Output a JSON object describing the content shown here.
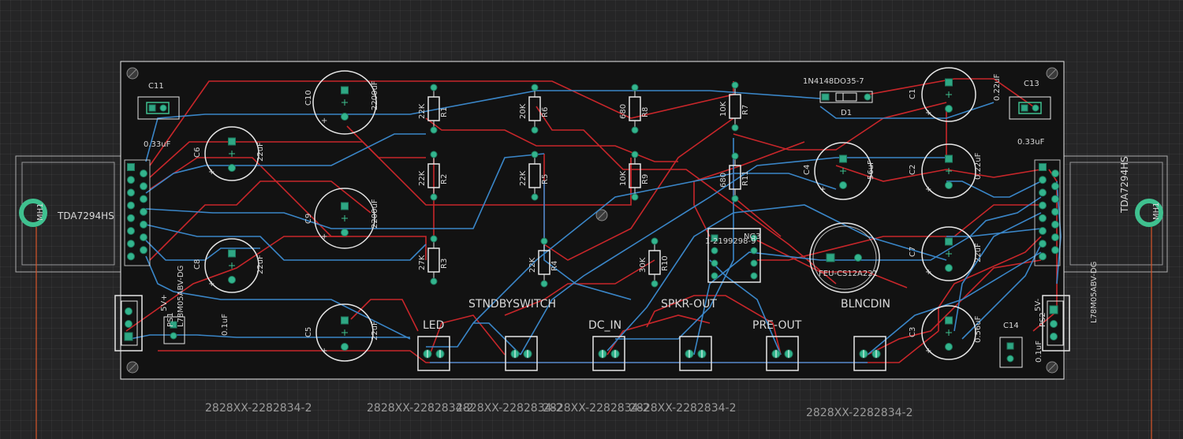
{
  "board": {
    "outline_color": "#e8e8e8",
    "bg": "#121212",
    "trace_top": "#c8262a",
    "trace_bottom": "#3a86c8",
    "pad_color": "#33b58e"
  },
  "mounting_holes": [
    {
      "label": "MH1"
    },
    {
      "label": "MH1"
    }
  ],
  "heatsinks": [
    {
      "label": "TDA7294HS"
    },
    {
      "label": "TDA7294HS"
    }
  ],
  "capacitors_small": [
    {
      "ref": "C11",
      "value": "0.33uF"
    },
    {
      "ref": "C13",
      "value": "0.33uF"
    },
    {
      "ref": "C14",
      "value": "0.1uF"
    },
    {
      "ref": "",
      "value": "0.1uF"
    }
  ],
  "electrolytics": [
    {
      "ref": "C10",
      "value": "2200uF"
    },
    {
      "ref": "C6",
      "value": "22uF"
    },
    {
      "ref": "C9",
      "value": "2200uF"
    },
    {
      "ref": "C8",
      "value": "22uF"
    },
    {
      "ref": "C5",
      "value": "22uF"
    },
    {
      "ref": "C1",
      "value": "0.22uF"
    },
    {
      "ref": "C4",
      "value": "56uF"
    },
    {
      "ref": "C2",
      "value": "0.22uF"
    },
    {
      "ref": "C7",
      "value": "22uF"
    },
    {
      "ref": "C3",
      "value": "0.56uF"
    }
  ],
  "resistors": [
    {
      "ref": "R1",
      "value": "22K"
    },
    {
      "ref": "R6",
      "value": "20K"
    },
    {
      "ref": "R8",
      "value": "680"
    },
    {
      "ref": "R7",
      "value": "10K"
    },
    {
      "ref": "R2",
      "value": "22K"
    },
    {
      "ref": "R5",
      "value": "22K"
    },
    {
      "ref": "R9",
      "value": "10K"
    },
    {
      "ref": "R11",
      "value": "680"
    },
    {
      "ref": "R3",
      "value": "27K"
    },
    {
      "ref": "R4",
      "value": "22K"
    },
    {
      "ref": "R10",
      "value": "30K"
    }
  ],
  "diode": {
    "ref": "D1",
    "value": "1N4148DO35-7"
  },
  "regulators": [
    {
      "label": "L78M05ABV-DG",
      "ref": "PS1",
      "pin_label": "5V+"
    },
    {
      "label": "L78M05ABV-DG",
      "ref": "PS2",
      "pin_label": "5V-"
    }
  ],
  "ic": {
    "label": "1-2199298-9",
    "ref": "NG3"
  },
  "buzzer": {
    "label": "FEU-CS12A221"
  },
  "connectors": [
    {
      "label": "LED"
    },
    {
      "label": "STNDBYSWITCH"
    },
    {
      "label": "DC_IN"
    },
    {
      "label": "SPKR-OUT"
    },
    {
      "label": "PRE-OUT"
    },
    {
      "label": "BLNCDIN"
    }
  ],
  "connector_part_labels": [
    "2828XX-2282834-2",
    "2828XX-2282834-2",
    "2828XX-2282834-2",
    "2828XX-2282834-2",
    "2828XX-2282834-2",
    "2828XX-2282834-2"
  ]
}
